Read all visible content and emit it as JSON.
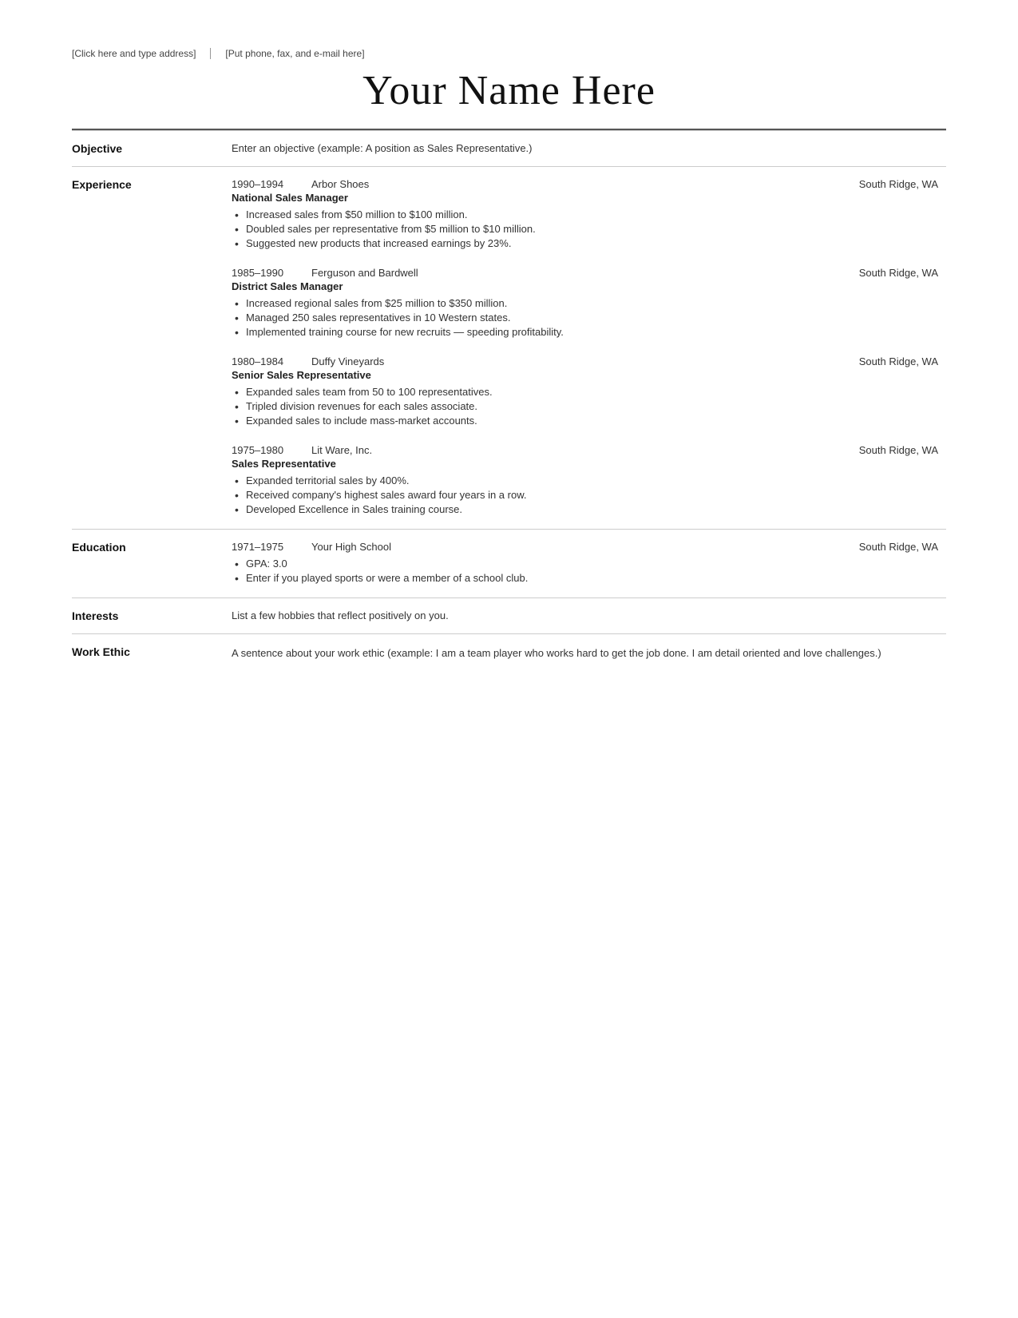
{
  "header": {
    "address_placeholder": "[Click here and type address]",
    "contact_placeholder": "[Put phone, fax, and e-mail here]",
    "name": "Your Name Here"
  },
  "sections": {
    "objective": {
      "label": "Objective",
      "text": "Enter an objective (example: A position as Sales Representative.)"
    },
    "experience": {
      "label": "Experience",
      "entries": [
        {
          "years": "1990–1994",
          "company": "Arbor Shoes",
          "location": "South Ridge, WA",
          "title": "National Sales Manager",
          "bullets": [
            "Increased sales from $50 million to $100 million.",
            "Doubled sales per representative from $5 million to $10 million.",
            "Suggested new products that increased earnings by 23%."
          ]
        },
        {
          "years": "1985–1990",
          "company": "Ferguson and Bardwell",
          "location": "South Ridge, WA",
          "title": "District Sales Manager",
          "bullets": [
            "Increased regional sales from $25 million to $350 million.",
            "Managed 250 sales representatives in 10 Western states.",
            "Implemented training course for new recruits — speeding profitability."
          ]
        },
        {
          "years": "1980–1984",
          "company": "Duffy Vineyards",
          "location": "South Ridge, WA",
          "title": "Senior Sales Representative",
          "bullets": [
            "Expanded sales team from 50 to 100 representatives.",
            "Tripled division revenues for each sales associate.",
            "Expanded sales to include mass-market accounts."
          ]
        },
        {
          "years": "1975–1980",
          "company": "Lit Ware, Inc.",
          "location": "South Ridge, WA",
          "title": "Sales Representative",
          "bullets": [
            "Expanded territorial sales by 400%.",
            "Received company's highest sales award four years in a row.",
            "Developed Excellence in Sales training course."
          ]
        }
      ]
    },
    "education": {
      "label": "Education",
      "years": "1971–1975",
      "school": "Your High School",
      "location": "South Ridge, WA",
      "bullets": [
        "GPA: 3.0",
        "Enter if you played sports or were a member of a school club."
      ]
    },
    "interests": {
      "label": "Interests",
      "text": "List a few hobbies that reflect positively on you."
    },
    "work_ethic": {
      "label": "Work Ethic",
      "text": "A sentence about your work ethic (example: I am a team player who works hard to get the job done. I am detail oriented and love challenges.)"
    }
  }
}
